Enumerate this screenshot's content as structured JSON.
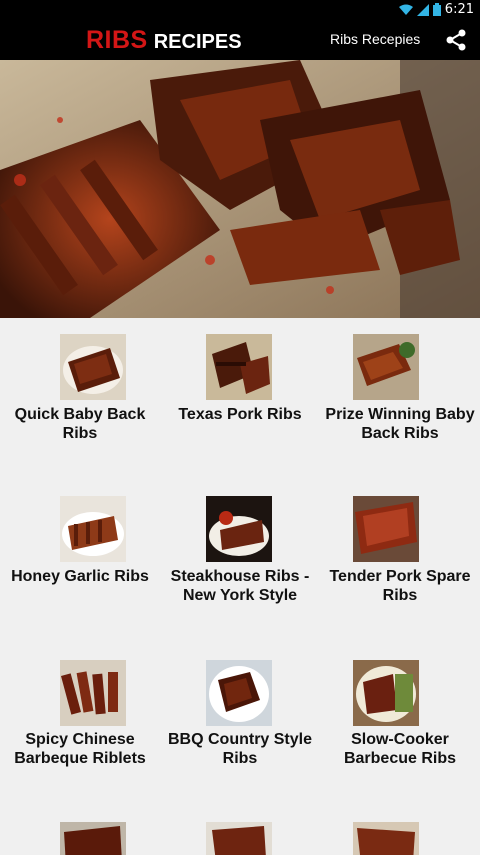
{
  "status": {
    "time": "6:21"
  },
  "header": {
    "logo_red": "RIBS",
    "logo_white": "RECIPES",
    "title": "Ribs Recepies",
    "share_icon": "share-icon"
  },
  "colors": {
    "brand_red": "#d31616",
    "background": "#f0f0f0",
    "bar": "#000000",
    "status_icon": "#33b5e5"
  },
  "recipes": [
    {
      "label": "Quick Baby Back Ribs"
    },
    {
      "label": "Texas Pork Ribs"
    },
    {
      "label": "Prize Winning Baby Back Ribs"
    },
    {
      "label": "Honey Garlic Ribs"
    },
    {
      "label": "Steakhouse Ribs - New York Style"
    },
    {
      "label": "Tender Pork Spare Ribs"
    },
    {
      "label": "Spicy Chinese Barbeque Riblets"
    },
    {
      "label": "BBQ Country Style Ribs"
    },
    {
      "label": "Slow-Cooker Barbecue Ribs"
    }
  ]
}
